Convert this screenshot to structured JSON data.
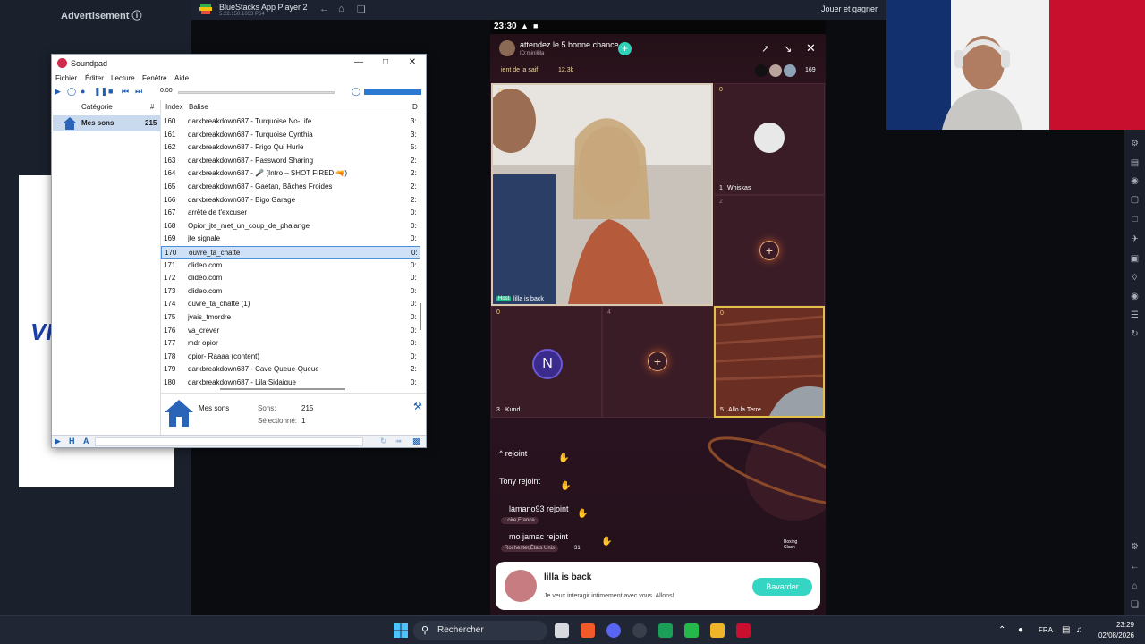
{
  "desktop": {
    "ad_label": "Advertisement ⓘ",
    "ad_logo": "VI"
  },
  "bluestacks": {
    "title": "BlueStacks App Player 2",
    "subtitle": "5.22.150.1033 P64",
    "play_label": "Jouer et gagner"
  },
  "phone": {
    "status_time": "23:30",
    "room_title": "attendez le 5 bonne chance",
    "room_id": "ID:minililla",
    "room_rank": "ient de la saif",
    "room_score": "12.3k",
    "viewer_count": "169",
    "seats": {
      "host_coin": "0",
      "host_label": "Host",
      "host_name": "lilla is back",
      "seat1_coin": "0",
      "seat1_num": "1",
      "seat1_name": "Whiskas",
      "seat2_num": "2",
      "seatn_coin": "0",
      "seatn_letter": "N",
      "seatn_num": "3",
      "seatn_name": "Kund",
      "seat4_num": "4",
      "seat5_coin": "0",
      "seat5_num": "5",
      "seat5_name": "Allo la Terre"
    },
    "chat": [
      {
        "name": "^ rejoint"
      },
      {
        "name": "Tony rejoint"
      },
      {
        "name": "lamano93 rejoint",
        "location": "Loire,France"
      },
      {
        "name": "mo jamac rejoint",
        "location": "Rochester,États Unis",
        "extra": "31"
      }
    ],
    "boxing_label": "Boxing Clash",
    "notification": {
      "title": "lilla is back",
      "message": "Je veux interagir intimement avec vous. Allons!",
      "button": "Bavarder"
    }
  },
  "soundpad": {
    "title": "Soundpad",
    "menu": [
      "Fichier",
      "Éditer",
      "Lecture",
      "Fenêtre",
      "Aide"
    ],
    "time": "0:00",
    "category_header": "Catégorie",
    "count_header": "#",
    "category_name": "Mes sons",
    "category_count": "215",
    "index_header": "Index",
    "balise_header": "Balise",
    "duration_header": "D",
    "rows": [
      {
        "index": "160",
        "name": "darkbreakdown687 - Turquoise No-Life",
        "dur": "3:"
      },
      {
        "index": "161",
        "name": "darkbreakdown687 - Turquoise Cynthia",
        "dur": "3:"
      },
      {
        "index": "162",
        "name": "darkbreakdown687 - Frigo Qui Hurle",
        "dur": "5:"
      },
      {
        "index": "163",
        "name": "darkbreakdown687 - Password Sharing",
        "dur": "2:"
      },
      {
        "index": "164",
        "name": "darkbreakdown687 - 🎤 (Intro – SHOT FIRED 🔫)",
        "dur": "2:"
      },
      {
        "index": "165",
        "name": "darkbreakdown687 - Gaétan, Bâches Froides",
        "dur": "2:"
      },
      {
        "index": "166",
        "name": "darkbreakdown687 - Bigo Garage",
        "dur": "2:"
      },
      {
        "index": "167",
        "name": "arrête de t'excuser",
        "dur": "0:"
      },
      {
        "index": "168",
        "name": "Opior_jte_met_un_coup_de_phalange",
        "dur": "0:"
      },
      {
        "index": "169",
        "name": "jte signale",
        "dur": "0:"
      },
      {
        "index": "170",
        "name": "ouvre_ta_chatte",
        "dur": "0:",
        "selected": true
      },
      {
        "index": "171",
        "name": "clideo.com",
        "dur": "0:"
      },
      {
        "index": "172",
        "name": "clideo.com",
        "dur": "0:"
      },
      {
        "index": "173",
        "name": "clideo.com",
        "dur": "0:"
      },
      {
        "index": "174",
        "name": "ouvre_ta_chatte (1)",
        "dur": "0:"
      },
      {
        "index": "175",
        "name": "jvais_tmordre",
        "dur": "0:"
      },
      {
        "index": "176",
        "name": "va_crever",
        "dur": "0:"
      },
      {
        "index": "177",
        "name": "mdr opior",
        "dur": "0:"
      },
      {
        "index": "178",
        "name": "opior- Raaaa (content)",
        "dur": "0:"
      },
      {
        "index": "179",
        "name": "darkbreakdown687 - Cave Queue-Queue",
        "dur": "2:"
      },
      {
        "index": "180",
        "name": "darkbreakdown687 - Lila Sidaique",
        "dur": "0:"
      }
    ],
    "info": {
      "name": "Mes sons",
      "sons_label": "Sons:",
      "sons_value": "215",
      "sel_label": "Sélectionné:",
      "sel_value": "1"
    },
    "status_buttons": [
      "▶",
      "H",
      "A"
    ]
  },
  "taskbar": {
    "search": "Rechercher",
    "lang": "FRA",
    "time": "23:29",
    "date": "02/08/2026"
  }
}
